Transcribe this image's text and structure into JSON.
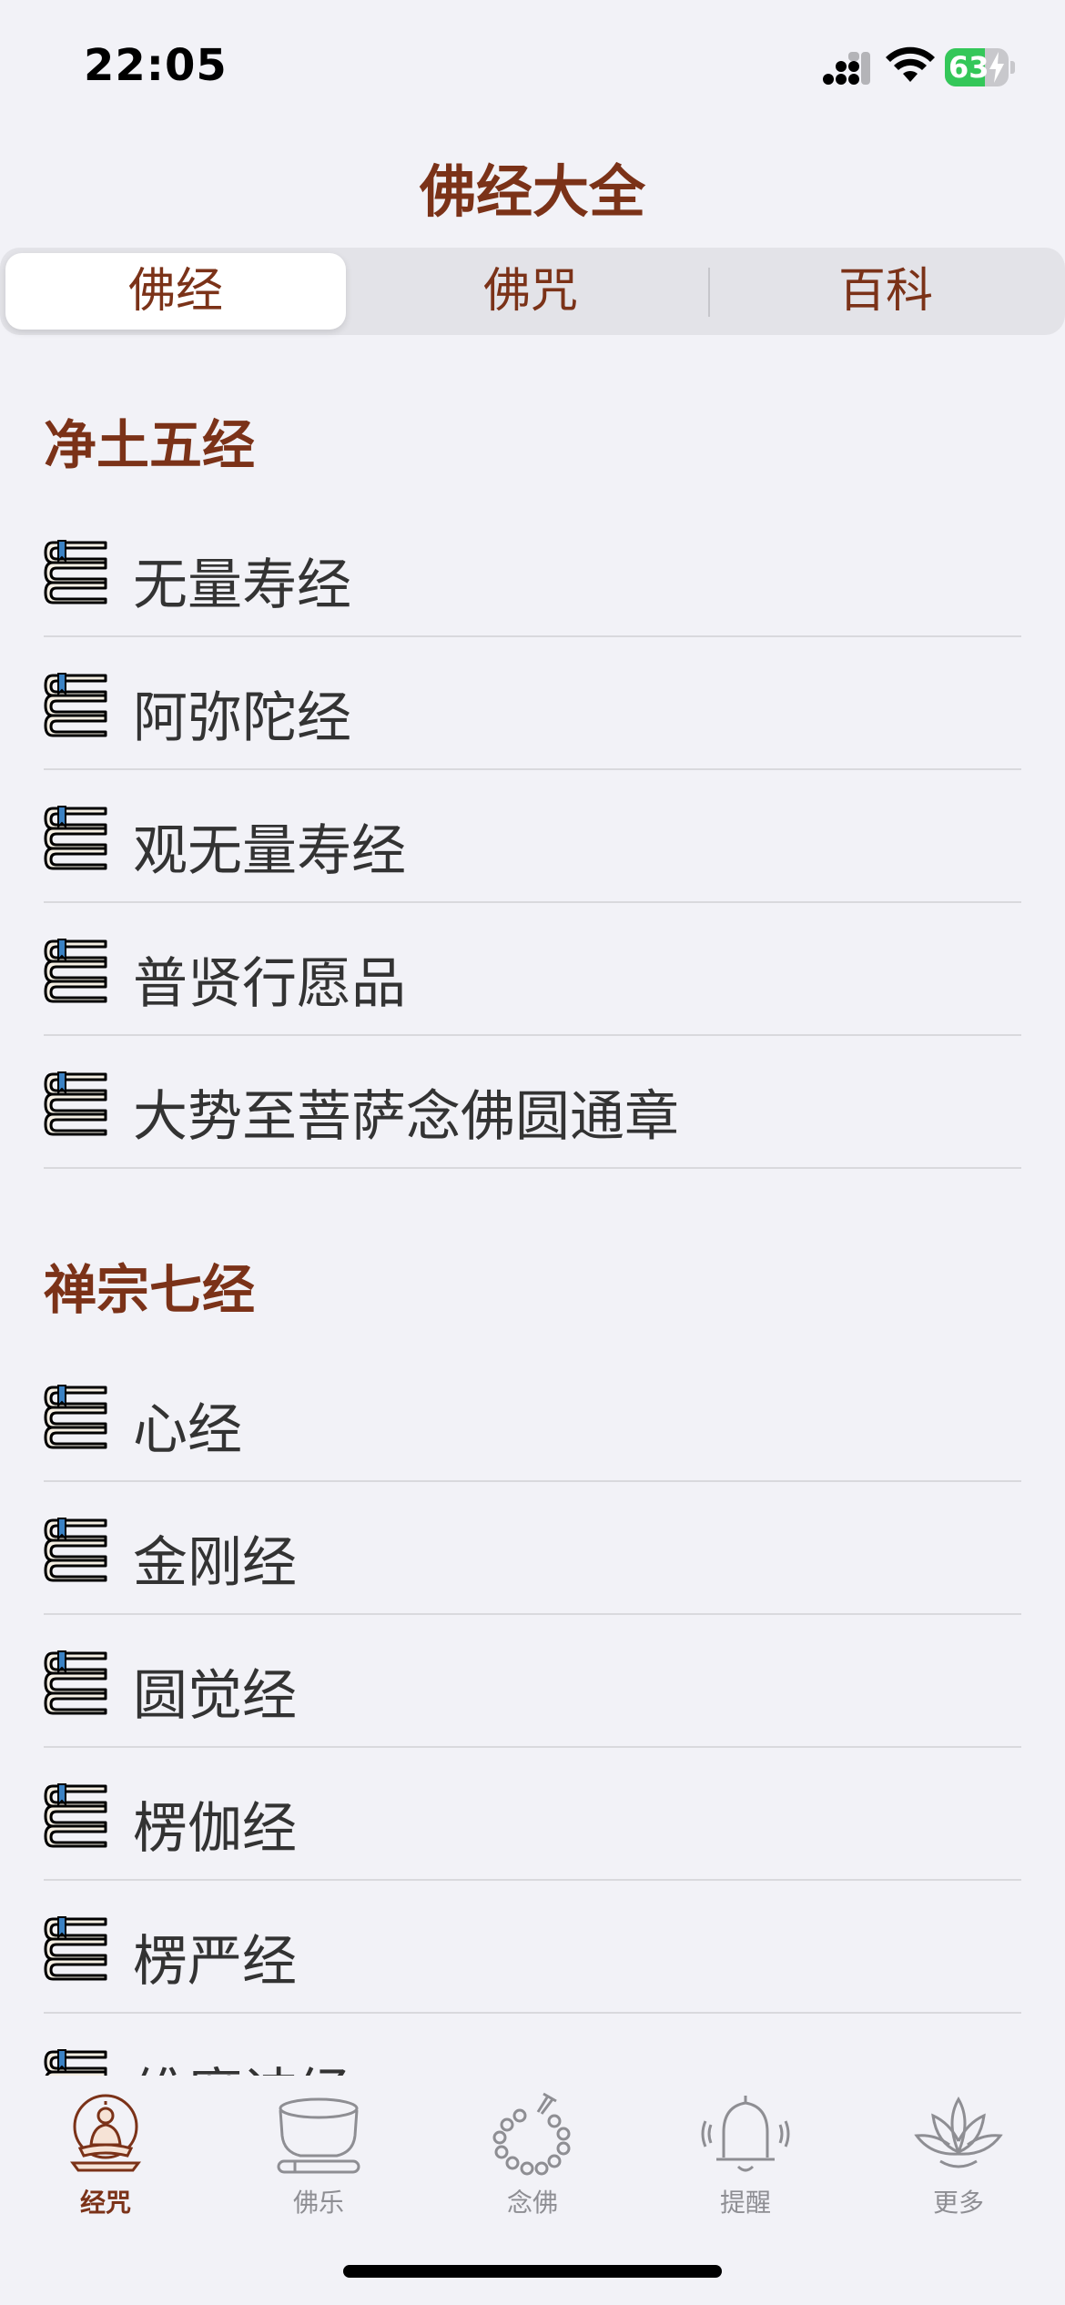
{
  "status_bar": {
    "time": "22:05",
    "battery_percent": "63",
    "battery_level": 0.63
  },
  "nav": {
    "title": "佛经大全"
  },
  "segments": [
    {
      "label": "佛经",
      "selected": true
    },
    {
      "label": "佛咒",
      "selected": false
    },
    {
      "label": "百科",
      "selected": false
    }
  ],
  "sections": [
    {
      "title": "净土五经",
      "items": [
        "无量寿经",
        "阿弥陀经",
        "观无量寿经",
        "普贤行愿品",
        "大势至菩萨念佛圆通章"
      ]
    },
    {
      "title": "禅宗七经",
      "items": [
        "心经",
        "金刚经",
        "圆觉经",
        "楞伽经",
        "楞严经",
        "维摩诘经"
      ]
    }
  ],
  "tabs": [
    {
      "label": "经咒",
      "icon": "buddha-icon",
      "selected": true
    },
    {
      "label": "佛乐",
      "icon": "singing-bowl-icon",
      "selected": false
    },
    {
      "label": "念佛",
      "icon": "prayer-beads-icon",
      "selected": false
    },
    {
      "label": "提醒",
      "icon": "bell-icon",
      "selected": false
    },
    {
      "label": "更多",
      "icon": "lotus-icon",
      "selected": false
    }
  ],
  "colors": {
    "accent": "#7b3218",
    "background": "#f2f2f7",
    "inactive": "#8e8e93",
    "battery": "#34c759"
  }
}
